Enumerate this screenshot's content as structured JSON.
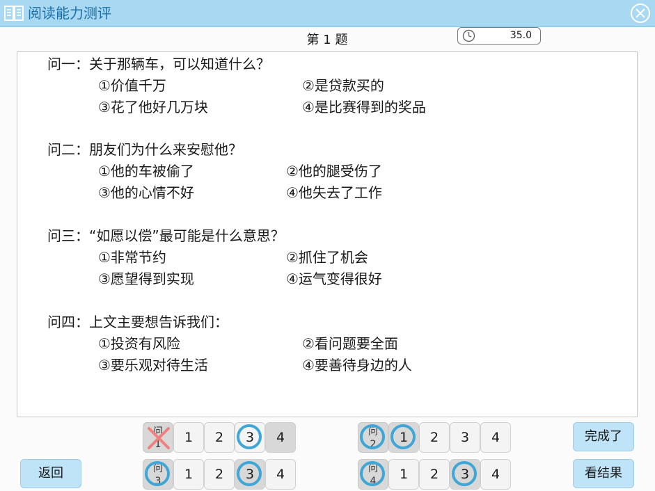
{
  "titlebar": {
    "title": "阅读能力测评"
  },
  "header": {
    "question_number": "第 1 题",
    "timer": "35.0"
  },
  "questions": [
    {
      "text": "问一：关于那辆车，可以知道什么？",
      "options": [
        "①价值千万",
        "②是贷款买的",
        "③花了他好几万块",
        "④是比赛得到的奖品"
      ]
    },
    {
      "text": "问二：朋友们为什么来安慰他？",
      "options": [
        "①他的车被偷了",
        "②他的腿受伤了",
        "③他的心情不好",
        "④他失去了工作"
      ]
    },
    {
      "text": "问三：“如愿以偿”最可能是什么意思？",
      "options": [
        "①非常节约",
        "②抓住了机会",
        "③愿望得到实现",
        "④运气变得很好"
      ]
    },
    {
      "text": "问四：上文主要想告诉我们：",
      "options": [
        "①投资有风险",
        "②看问题要全面",
        "③要乐观对待生活",
        "④要善待身边的人"
      ]
    }
  ],
  "answer_rows": [
    {
      "label_top": "问",
      "label_bottom": "1",
      "choices": [
        "1",
        "2",
        "3",
        "4"
      ],
      "marked": "3",
      "shaded": "4",
      "label_state": "wrong"
    },
    {
      "label_top": "问",
      "label_bottom": "2",
      "choices": [
        "1",
        "2",
        "3",
        "4"
      ],
      "marked": "1",
      "shaded": "1",
      "label_state": "circled"
    },
    {
      "label_top": "问",
      "label_bottom": "3",
      "choices": [
        "1",
        "2",
        "3",
        "4"
      ],
      "marked": "3",
      "shaded": "3",
      "label_state": "circled"
    },
    {
      "label_top": "问",
      "label_bottom": "4",
      "choices": [
        "1",
        "2",
        "3",
        "4"
      ],
      "marked": "3",
      "shaded": "3",
      "label_state": "circled"
    }
  ],
  "buttons": {
    "back": "返回",
    "done": "完成了",
    "results": "看结果"
  },
  "colors": {
    "titlebar": "#a8d8f2",
    "title_text": "#1b6fa8",
    "ring": "#3fa6d6",
    "wrong_mark": "#f08080",
    "button": "#bfe4f7"
  }
}
